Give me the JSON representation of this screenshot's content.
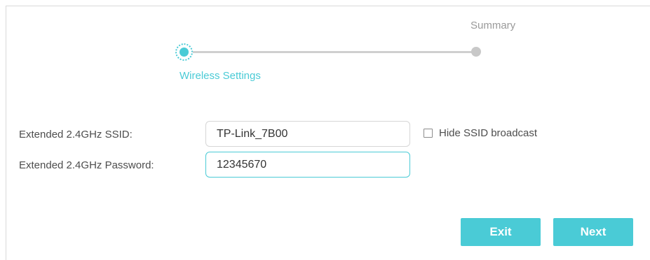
{
  "stepper": {
    "steps": [
      {
        "label": "Wireless Settings",
        "state": "active"
      },
      {
        "label": "Summary",
        "state": "pending"
      }
    ],
    "active_color": "#4acbd6",
    "inactive_color": "#c8c8c8"
  },
  "form": {
    "ssid": {
      "label": "Extended 2.4GHz SSID:",
      "value": "TP-Link_7B00"
    },
    "password": {
      "label": "Extended 2.4GHz Password:",
      "value": "12345670"
    },
    "hide_ssid": {
      "label": "Hide SSID broadcast",
      "checked": false
    }
  },
  "actions": {
    "exit_label": "Exit",
    "next_label": "Next",
    "color": "#4acbd6"
  }
}
